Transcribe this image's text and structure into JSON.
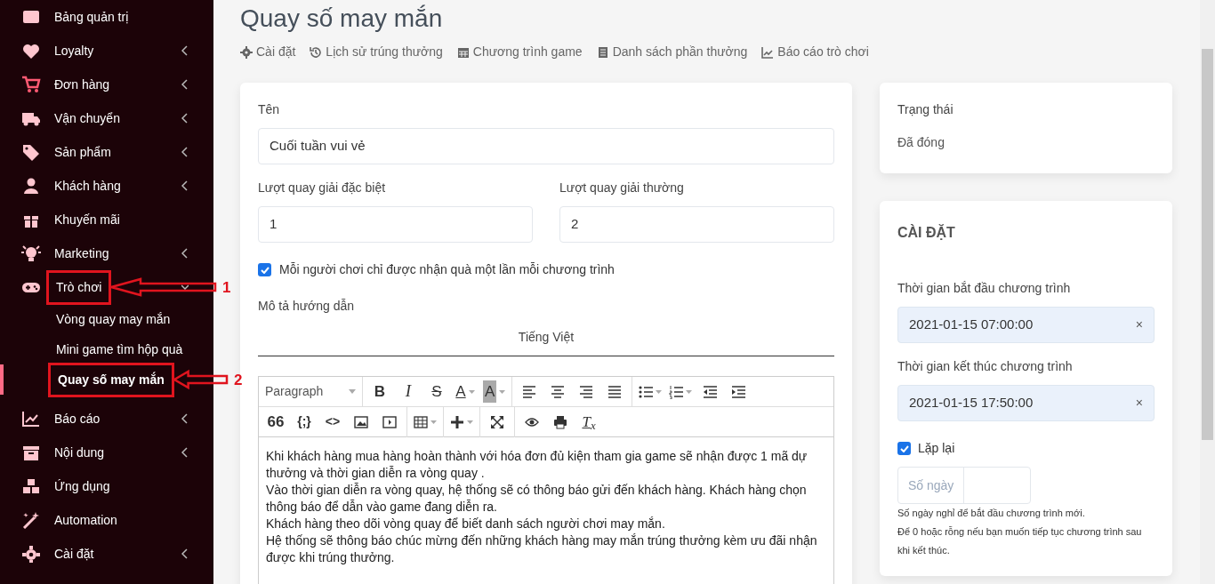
{
  "sidebar": {
    "items": [
      {
        "label": "Bảng quản trị",
        "has_submenu": false
      },
      {
        "label": "Loyalty",
        "has_submenu": true
      },
      {
        "label": "Đơn hàng",
        "has_submenu": true
      },
      {
        "label": "Vận chuyển",
        "has_submenu": true
      },
      {
        "label": "Sản phẩm",
        "has_submenu": true
      },
      {
        "label": "Khách hàng",
        "has_submenu": true
      },
      {
        "label": "Khuyến mãi",
        "has_submenu": false
      },
      {
        "label": "Marketing",
        "has_submenu": true
      },
      {
        "label": "Trò chơi",
        "has_submenu": true,
        "expanded": true,
        "annotation": "1",
        "children": [
          {
            "label": "Vòng quay may mắn",
            "selected": false
          },
          {
            "label": "Mini game tìm hộp quà",
            "selected": false
          },
          {
            "label": "Quay số may mắn",
            "selected": true,
            "annotation": "2"
          }
        ]
      },
      {
        "label": "Báo cáo",
        "has_submenu": true
      },
      {
        "label": "Nội dung",
        "has_submenu": true
      },
      {
        "label": "Ứng dụng",
        "has_submenu": false
      },
      {
        "label": "Automation",
        "has_submenu": false
      },
      {
        "label": "Cài đặt",
        "has_submenu": true
      }
    ]
  },
  "page_title": "Quay số may mắn",
  "tabs": [
    {
      "label": "Cài đặt"
    },
    {
      "label": "Lịch sử trúng thưởng"
    },
    {
      "label": "Chương trình game"
    },
    {
      "label": "Danh sách phần thưởng"
    },
    {
      "label": "Báo cáo trò chơi"
    }
  ],
  "form": {
    "name_label": "Tên",
    "name_value": "Cuối tuần vui vẻ",
    "special_label": "Lượt quay giải đặc biệt",
    "special_value": "1",
    "normal_label": "Lượt quay giải thường",
    "normal_value": "2",
    "once_checkbox": {
      "label": "Mỗi người chơi chỉ được nhận quà một lần mỗi chương trình",
      "checked": true
    },
    "description_label": "Mô tả hướng dẫn",
    "language_tab": "Tiếng Việt",
    "toolbar": [
      [
        [
          {
            "kind": "dropdown",
            "text": "Paragraph"
          }
        ],
        [
          {
            "kind": "glyph",
            "text": "B"
          },
          {
            "kind": "glyph",
            "text": "I"
          },
          {
            "kind": "glyph",
            "text": "S"
          },
          {
            "kind": "glyph",
            "text": "A",
            "has_menu": true
          },
          {
            "kind": "glyph",
            "text": "A",
            "has_menu": true
          }
        ],
        [
          {
            "kind": "icon"
          },
          {
            "kind": "icon"
          },
          {
            "kind": "icon"
          },
          {
            "kind": "icon"
          }
        ],
        [
          {
            "kind": "icon",
            "has_menu": true
          },
          {
            "kind": "icon",
            "has_menu": true
          },
          {
            "kind": "icon"
          },
          {
            "kind": "icon"
          }
        ]
      ],
      [
        [
          {
            "kind": "glyph",
            "text": "66"
          },
          {
            "kind": "glyph",
            "text": "{;}"
          },
          {
            "kind": "glyph",
            "text": "<>"
          },
          {
            "kind": "icon"
          },
          {
            "kind": "icon"
          }
        ],
        [
          {
            "kind": "icon",
            "has_menu": true
          }
        ],
        [
          {
            "kind": "icon",
            "has_menu": true
          }
        ],
        [
          {
            "kind": "icon"
          }
        ],
        [
          {
            "kind": "icon"
          },
          {
            "kind": "icon"
          },
          {
            "kind": "glyph",
            "text": "T$_{x}$"
          }
        ]
      ]
    ],
    "content": [
      "Khi khách hàng mua hàng hoàn thành với hóa đơn đủ kiện tham gia game sẽ nhận được 1 mã dự thưởng và thời gian diễn ra vòng quay .",
      "Vào thời gian diễn ra vòng quay, hệ thống sẽ có thông báo gửi đến khách hàng. Khách hàng chọn thông báo để dẫn vào game đang diễn ra.",
      "Khách hàng theo dõi vòng quay để biết danh sách người chơi may mắn.",
      "Hệ thống sẽ thông báo chúc mừng đến những khách hàng may mắn trúng thưởng kèm ưu đãi nhận được khi trúng thưởng."
    ]
  },
  "status": {
    "label": "Trạng thái",
    "value": "Đã đóng"
  },
  "settings": {
    "title": "CÀI ĐẶT",
    "start_label": "Thời gian bắt đầu chương trình",
    "start_value": "2021-01-15 07:00:00",
    "end_label": "Thời gian kết thúc chương trình",
    "end_value": "2021-01-15 17:50:00",
    "clear_glyph": "×",
    "repeat": {
      "label": "Lặp lại",
      "checked": true
    },
    "days_addon": "Số ngày",
    "help": [
      "Số ngày nghỉ để bắt đầu chương trình mới.",
      "Để 0 hoặc rỗng nếu bạn muốn tiếp tục chương trình sau khi kết thúc."
    ]
  }
}
